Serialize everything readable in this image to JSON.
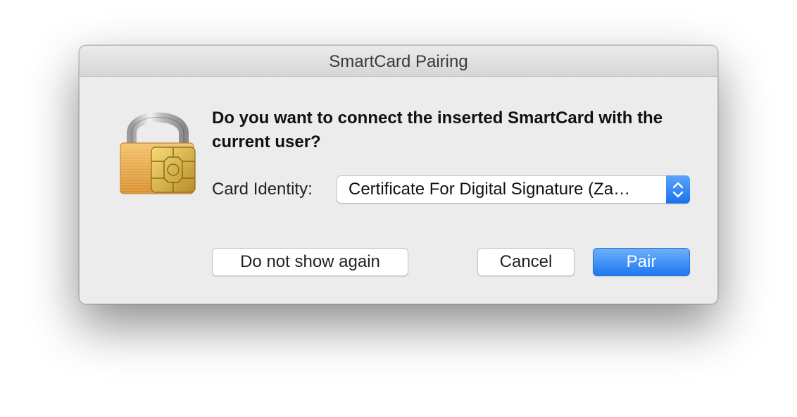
{
  "window": {
    "title": "SmartCard Pairing"
  },
  "dialog": {
    "question": "Do you want to connect the inserted SmartCard with the current user?",
    "card_identity_label": "Card Identity:",
    "card_identity_value": "Certificate For Digital Signature (Za…",
    "icon": "smartcard-lock-icon"
  },
  "buttons": {
    "do_not_show": "Do not show again",
    "cancel": "Cancel",
    "pair": "Pair"
  },
  "colors": {
    "accent": "#1f78f0",
    "dialog_background": "#ececec",
    "lock_gold": "#e9a94b",
    "chip_gold": "#d9b545"
  }
}
